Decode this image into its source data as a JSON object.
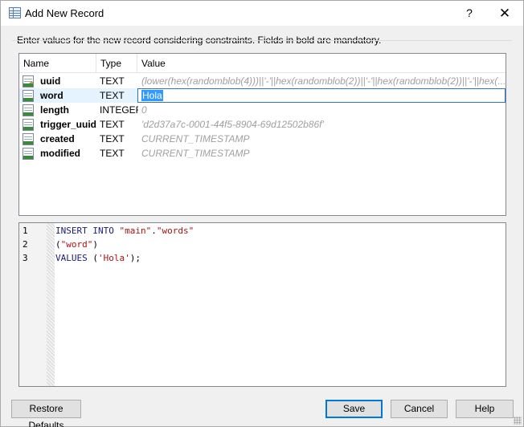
{
  "window": {
    "title": "Add New Record",
    "help_glyph": "?",
    "close_glyph": "✕"
  },
  "instruction": "Enter values for the new record considering constraints. Fields in bold are mandatory.",
  "columns": {
    "name": "Name",
    "type": "Type",
    "value": "Value"
  },
  "fields": [
    {
      "name": "uuid",
      "type": "TEXT",
      "value": "(lower(hex(randomblob(4)))||'-'||hex(randomblob(2))||'-'||hex(randomblob(2))||'-'||hex(...",
      "icon": "key-field-icon"
    },
    {
      "name": "word",
      "type": "TEXT",
      "value": "Hola",
      "icon": "field-icon",
      "selected": true
    },
    {
      "name": "length",
      "type": "INTEGER",
      "value": "0",
      "icon": "field-icon"
    },
    {
      "name": "trigger_uuid",
      "type": "TEXT",
      "value": "'d2d37a7c-0001-44f5-8904-69d12502b86f'",
      "icon": "field-icon"
    },
    {
      "name": "created",
      "type": "TEXT",
      "value": "CURRENT_TIMESTAMP",
      "icon": "field-icon"
    },
    {
      "name": "modified",
      "type": "TEXT",
      "value": "CURRENT_TIMESTAMP",
      "icon": "field-icon"
    }
  ],
  "sql": {
    "line_numbers": [
      "1",
      "2",
      "3"
    ],
    "line1": {
      "kw1": "INSERT INTO ",
      "s1": "\"main\"",
      "dot": ".",
      "s2": "\"words\""
    },
    "line2": {
      "open": "(",
      "s1": "\"word\"",
      "close": ")"
    },
    "line3": {
      "kw1": "VALUES ",
      "open": "(",
      "s1": "'Hola'",
      "close": ");"
    }
  },
  "buttons": {
    "restore": "Restore Defaults",
    "save": "Save",
    "cancel": "Cancel",
    "help": "Help"
  },
  "colors": {
    "selection": "#3399ff",
    "row_highlight": "#e5f3ff",
    "default_button_border": "#0078d7",
    "string": "#b01010",
    "keyword": "#1a1a7a"
  }
}
